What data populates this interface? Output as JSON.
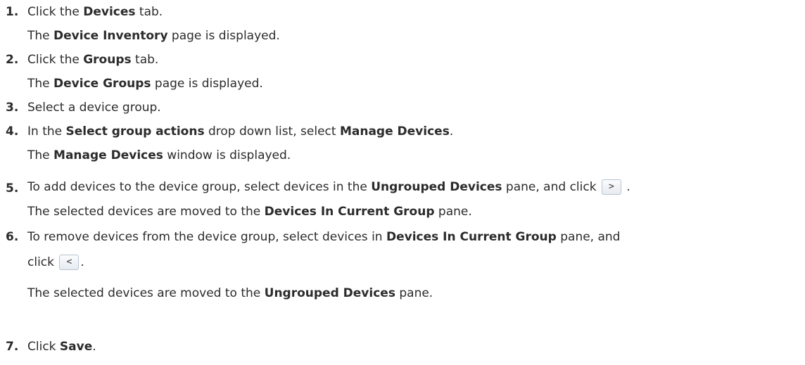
{
  "steps": [
    {
      "number": "1.",
      "parts": [
        "Click the ",
        "Devices",
        " tab."
      ],
      "result": [
        "The ",
        "Device Inventory",
        " page is displayed."
      ]
    },
    {
      "number": "2.",
      "parts": [
        "Click the ",
        "Groups",
        " tab."
      ],
      "result": [
        "The ",
        "Device Groups",
        " page is displayed."
      ]
    },
    {
      "number": "3.",
      "parts": [
        "Select a device group."
      ]
    },
    {
      "number": "4.",
      "parts": [
        "In the ",
        "Select group actions",
        " drop down list, select ",
        "Manage Devices",
        "."
      ],
      "result": [
        "The ",
        "Manage Devices",
        " window is displayed."
      ]
    },
    {
      "number": "5.",
      "parts": [
        "To add devices to the device group, select devices in the ",
        "Ungrouped Devices",
        " pane, and click ",
        " ."
      ],
      "button": ">",
      "result": [
        "The selected devices are moved to the ",
        "Devices In Current Group",
        " pane."
      ]
    },
    {
      "number": "6.",
      "parts": [
        "To remove devices from the device group, select devices in ",
        "Devices In Current Group",
        " pane, and"
      ],
      "continuation": [
        "click ",
        "."
      ],
      "button": "<",
      "result": [
        "The selected devices are moved to the ",
        "Ungrouped Devices",
        " pane."
      ]
    },
    {
      "number": "7.",
      "parts": [
        "Click ",
        "Save",
        "."
      ]
    }
  ]
}
